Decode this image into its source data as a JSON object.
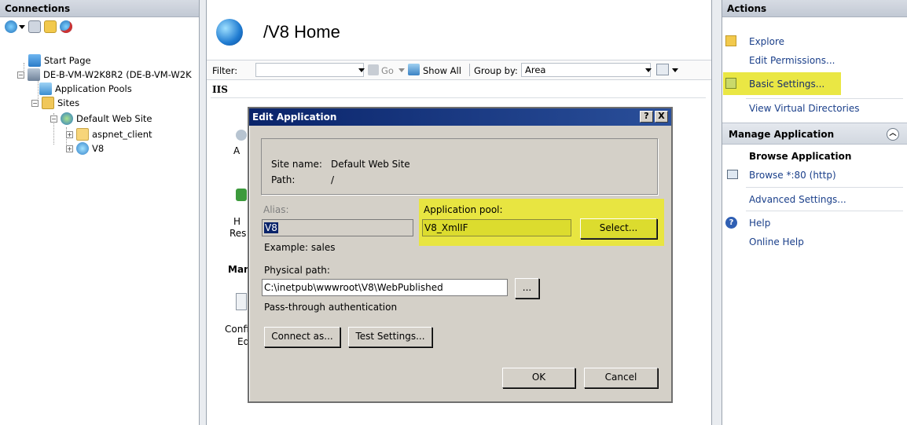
{
  "connections": {
    "header": "Connections",
    "tree": [
      {
        "label": "Start Page"
      },
      {
        "label": "DE-B-VM-W2K8R2 (DE-B-VM-W2K"
      },
      {
        "label": "Application Pools"
      },
      {
        "label": "Sites"
      },
      {
        "label": "Default Web Site"
      },
      {
        "label": "aspnet_client"
      },
      {
        "label": "V8"
      }
    ]
  },
  "center": {
    "title": "/V8 Home",
    "filter_label": "Filter:",
    "go_label": "Go",
    "show_all_label": "Show All",
    "group_by_label": "Group by:",
    "group_by_value": "Area",
    "iis_header": "IIS",
    "partial_texts": {
      "a": "A",
      "h": "H",
      "res": "Res",
      "man": "Man",
      "config": "Config",
      "ed": "Ed"
    }
  },
  "dialog": {
    "title": "Edit Application",
    "help_button": "?",
    "close_button": "X",
    "site_name_label": "Site name:",
    "site_name_value": "Default Web Site",
    "path_label": "Path:",
    "path_value": "/",
    "alias_label": "Alias:",
    "alias_value": "V8",
    "app_pool_label": "Application pool:",
    "app_pool_value": "V8_XmlIF",
    "select_button": "Select...",
    "example_text": "Example: sales",
    "physical_path_label": "Physical path:",
    "physical_path_value": "C:\\inetpub\\wwwroot\\V8\\WebPublished",
    "browse_button": "...",
    "pass_through_label": "Pass-through authentication",
    "connect_as_button": "Connect as...",
    "test_settings_button": "Test Settings...",
    "ok_button": "OK",
    "cancel_button": "Cancel"
  },
  "actions": {
    "header": "Actions",
    "explore": "Explore",
    "edit_permissions": "Edit Permissions...",
    "basic_settings": "Basic Settings...",
    "view_virtual_directories": "View Virtual Directories",
    "manage_application_header": "Manage Application",
    "browse_application": "Browse Application",
    "browse_80": "Browse *:80 (http)",
    "advanced_settings": "Advanced Settings...",
    "help": "Help",
    "online_help": "Online Help"
  },
  "colors": {
    "highlight": "#e9e63a",
    "dialog_title_bar": "#0a246a",
    "link": "#1a3f8a"
  }
}
